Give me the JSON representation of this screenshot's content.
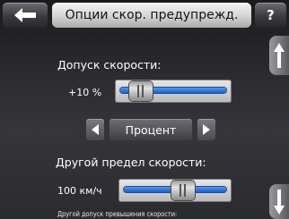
{
  "header": {
    "back_icon": "left-arrow-icon",
    "title": "Опции скор. предупрежд.",
    "help_label": "?"
  },
  "scroll": {
    "up_icon": "up-arrow-icon",
    "down_icon": "down-arrow-icon"
  },
  "speed_tolerance": {
    "label": "Допуск скорости:",
    "value": "+10",
    "unit": "%",
    "slider_level": 0.12
  },
  "mode_selector": {
    "left_icon": "left-triangle-icon",
    "selected": "Процент",
    "right_icon": "right-triangle-icon"
  },
  "other_limit": {
    "label": "Другой предел скорости:",
    "value": "100",
    "unit": "км/ч",
    "slider_level": 0.6
  },
  "footnote": "Другой допуск превышения скорости:",
  "colors": {
    "slider_fill": "#2f79dd",
    "title_bg": "#d6d6d6",
    "background": "#2b2c31"
  }
}
